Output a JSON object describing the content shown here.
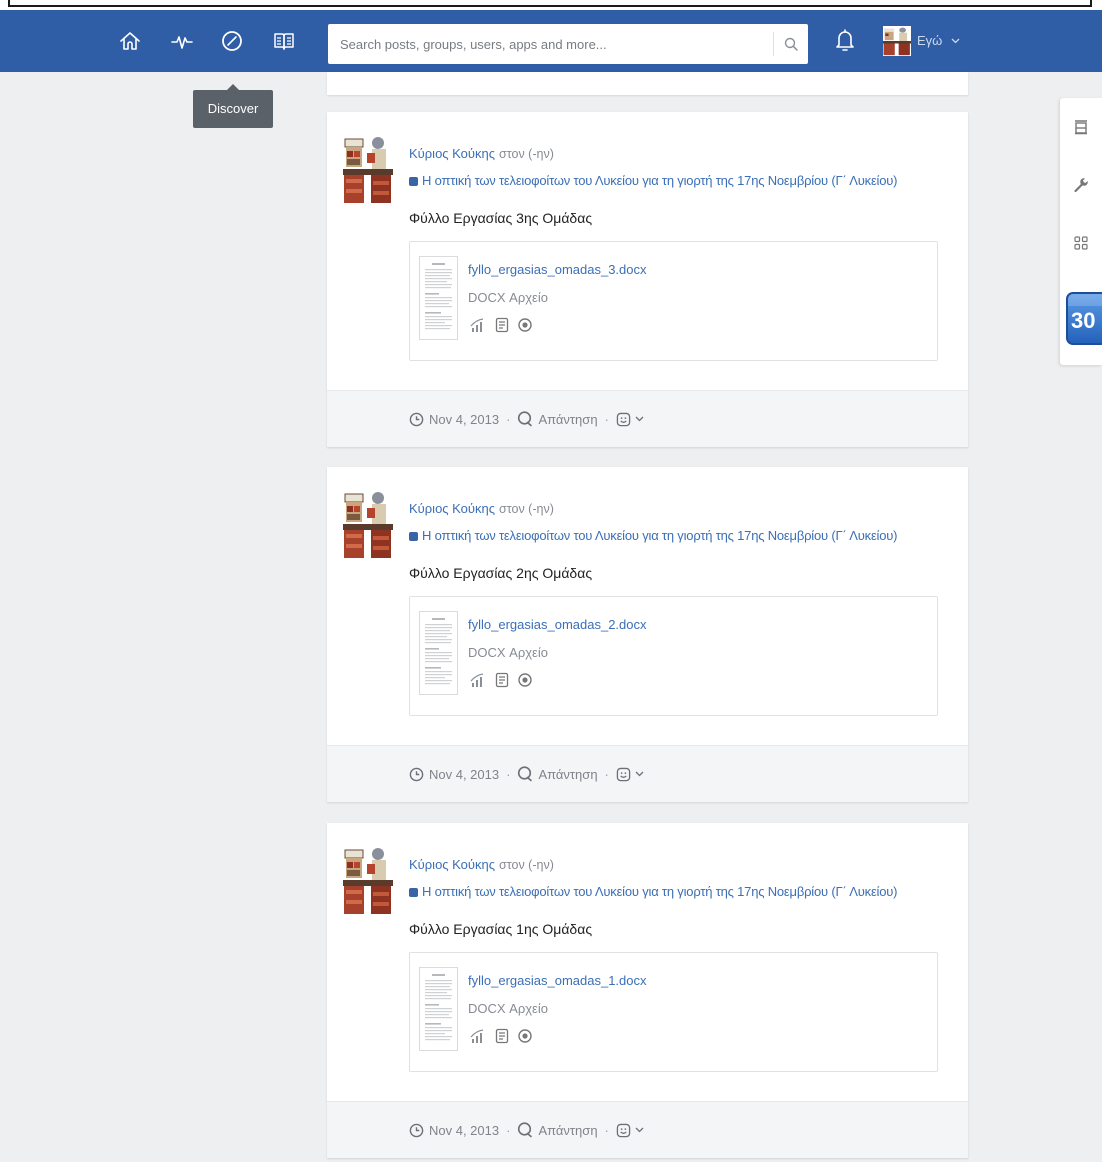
{
  "nav": {
    "icons": [
      {
        "icon": "home-icon",
        "active": false
      },
      {
        "icon": "activity-icon",
        "active": false
      },
      {
        "icon": "compass-icon",
        "active": true
      },
      {
        "icon": "directory-icon",
        "active": false
      }
    ],
    "search": {
      "placeholder": "Search posts, groups, users, apps and more..."
    },
    "user": {
      "label": "Εγώ"
    }
  },
  "tooltip": {
    "text": "Discover"
  },
  "labels": {
    "separator": "·",
    "reply": "Απάντηση"
  },
  "posts": [
    {
      "author": "Κύριος Κούκης",
      "audience": "στον (-ην)",
      "group": "Η οπτική των τελειοφοίτων του Λυκείου για τη γιορτή της 17ης Νοεμβρίου (Γ΄ Λυκείου)",
      "title": "Φύλλο Εργασίας 3ης Ομάδας",
      "attachment": {
        "filename": "fyllo_ergasias_omadas_3.docx",
        "type": "DOCX Αρχείο"
      },
      "date": "Nov 4, 2013"
    },
    {
      "author": "Κύριος Κούκης",
      "audience": "στον (-ην)",
      "group": "Η οπτική των τελειοφοίτων του Λυκείου για τη γιορτή της 17ης Νοεμβρίου (Γ΄ Λυκείου)",
      "title": "Φύλλο Εργασίας 2ης Ομάδας",
      "attachment": {
        "filename": "fyllo_ergasias_omadas_2.docx",
        "type": "DOCX Αρχείο"
      },
      "date": "Nov 4, 2013"
    },
    {
      "author": "Κύριος Κούκης",
      "audience": "στον (-ην)",
      "group": "Η οπτική των τελειοφοίτων του Λυκείου για τη γιορτή της 17ης Νοεμβρίου (Γ΄ Λυκείου)",
      "title": "Φύλλο Εργασίας 1ης Ομάδας",
      "attachment": {
        "filename": "fyllo_ergasias_omadas_1.docx",
        "type": "DOCX Αρχείο"
      },
      "date": "Nov 4, 2013"
    }
  ],
  "right_panel": {
    "items": [
      "store-icon",
      "wrench-icon",
      "apps-grid-icon",
      "calendar-icon"
    ],
    "calendar_day": "30"
  },
  "colors": {
    "nav": "#2f5da6",
    "link": "#3b6fb6",
    "tooltip": "#5b6169",
    "page": "#edeff1",
    "footer": "#f4f5f6"
  }
}
